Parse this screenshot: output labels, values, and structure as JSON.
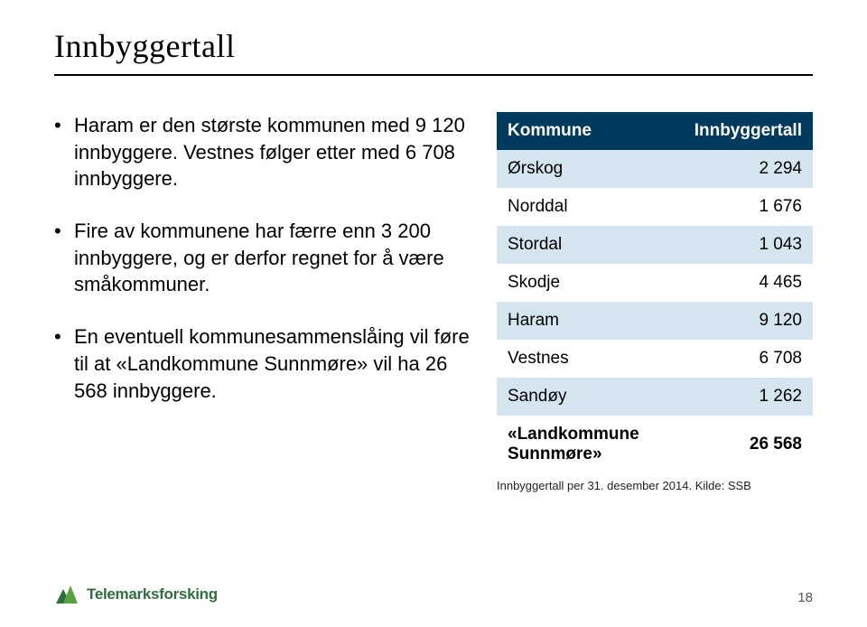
{
  "title": "Innbyggertall",
  "bullets": [
    "Haram er den største kommunen med 9 120 innbyggere. Vestnes følger etter med 6 708 innbyggere.",
    "Fire av kommunene har færre enn 3 200 innbyggere, og er derfor regnet for å være småkommuner.",
    "En eventuell kommunesammenslåing vil føre til at «Landkommune Sunnmøre» vil ha 26 568 innbyggere."
  ],
  "table": {
    "headers": [
      "Kommune",
      "Innbyggertall"
    ],
    "rows": [
      {
        "name": "Ørskog",
        "value": "2 294"
      },
      {
        "name": "Norddal",
        "value": "1 676"
      },
      {
        "name": "Stordal",
        "value": "1 043"
      },
      {
        "name": "Skodje",
        "value": "4 465"
      },
      {
        "name": "Haram",
        "value": "9 120"
      },
      {
        "name": "Vestnes",
        "value": "6 708"
      },
      {
        "name": "Sandøy",
        "value": "1 262"
      },
      {
        "name": "«Landkommune Sunnmøre»",
        "value": "26 568"
      }
    ],
    "source": "Innbyggertall per 31. desember 2014. Kilde: SSB"
  },
  "footer": {
    "logo_text": "Telemarksforsking",
    "page_number": "18"
  },
  "chart_data": {
    "type": "table",
    "title": "Innbyggertall",
    "columns": [
      "Kommune",
      "Innbyggertall"
    ],
    "rows": [
      [
        "Ørskog",
        2294
      ],
      [
        "Norddal",
        1676
      ],
      [
        "Stordal",
        1043
      ],
      [
        "Skodje",
        4465
      ],
      [
        "Haram",
        9120
      ],
      [
        "Vestnes",
        6708
      ],
      [
        "Sandøy",
        1262
      ],
      [
        "«Landkommune Sunnmøre»",
        26568
      ]
    ],
    "note": "Innbyggertall per 31. desember 2014. Kilde: SSB"
  }
}
